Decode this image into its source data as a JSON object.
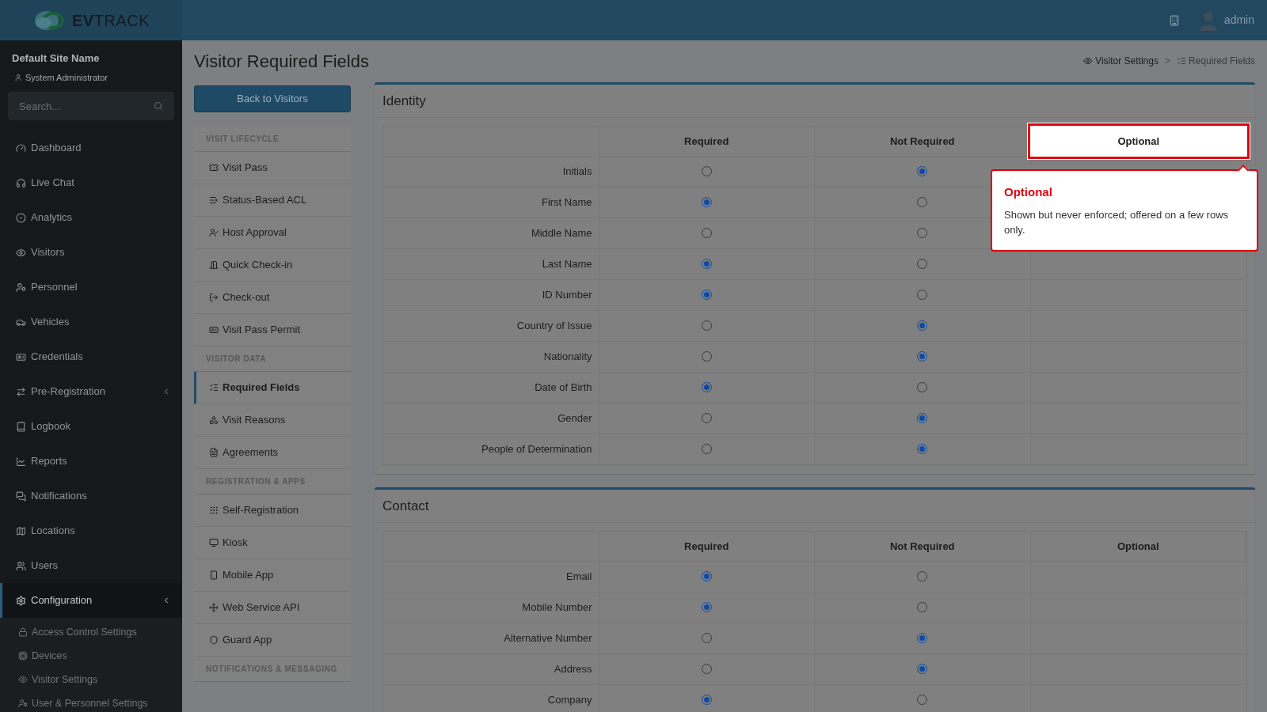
{
  "header": {
    "logo": "**EV**TRACK",
    "user": "admin"
  },
  "sidebar": {
    "site": "Default Site Name",
    "role": "System Administrator",
    "search": {
      "placeholder": "Search..."
    },
    "items": [
      {
        "label": "Dashboard",
        "kind": "link",
        "selected": false
      },
      {
        "label": "Live Chat",
        "kind": "link",
        "selected": false
      },
      {
        "label": "Analytics",
        "kind": "link",
        "selected": false
      },
      {
        "label": "Visitors",
        "kind": "link",
        "selected": false
      },
      {
        "label": "Personnel",
        "kind": "link",
        "selected": false
      },
      {
        "label": "Vehicles",
        "kind": "link",
        "selected": false
      },
      {
        "label": "Credentials",
        "kind": "link",
        "selected": false
      },
      {
        "label": "Pre-Registration",
        "kind": "group",
        "selected": false
      },
      {
        "label": "Logbook",
        "kind": "link",
        "selected": false
      },
      {
        "label": "Reports",
        "kind": "link",
        "selected": false
      },
      {
        "label": "Notifications",
        "kind": "link",
        "selected": false
      },
      {
        "label": "Locations",
        "kind": "link",
        "selected": false
      },
      {
        "label": "Users",
        "kind": "link",
        "selected": false
      },
      {
        "label": "Configuration",
        "kind": "group",
        "selected": true,
        "children": [
          {
            "label": "Access Control Settings"
          },
          {
            "label": "Devices"
          },
          {
            "label": "Visitor Settings"
          },
          {
            "label": "User & Personnel Settings"
          }
        ]
      }
    ]
  },
  "page": {
    "title": "Visitor Required Fields",
    "back_button": "Back to Visitors",
    "breadcrumb": [
      {
        "label": "Visitor Settings"
      },
      {
        "label": "Required Fields"
      }
    ],
    "breadcrumb_separator": ">"
  },
  "settings_menu": [
    {
      "heading": "VISIT LIFECYCLE",
      "items": [
        {
          "label": "Visit Pass",
          "selected": false
        },
        {
          "label": "Status-Based ACL",
          "selected": false
        },
        {
          "label": "Host Approval",
          "selected": false
        },
        {
          "label": "Quick Check-in",
          "selected": false
        },
        {
          "label": "Check-out",
          "selected": false
        },
        {
          "label": "Visit Pass Permit",
          "selected": false
        }
      ]
    },
    {
      "heading": "VISITOR DATA",
      "items": [
        {
          "label": "Required Fields",
          "selected": true
        },
        {
          "label": "Visit Reasons",
          "selected": false
        },
        {
          "label": "Agreements",
          "selected": false
        }
      ]
    },
    {
      "heading": "REGISTRATION & APPS",
      "items": [
        {
          "label": "Self-Registration",
          "selected": false
        },
        {
          "label": "Kiosk",
          "selected": false
        },
        {
          "label": "Mobile App",
          "selected": false
        },
        {
          "label": "Web Service API",
          "selected": false
        },
        {
          "label": "Guard App",
          "selected": false
        }
      ]
    },
    {
      "heading": "NOTIFICATIONS & MESSAGING"
    }
  ],
  "sections": [
    {
      "title": "Identity",
      "columns": [
        {
          "label": "Required",
          "highlighted": false
        },
        {
          "label": "Not Required",
          "highlighted": false
        },
        {
          "label": "Optional",
          "highlighted": true
        }
      ],
      "rows": [
        {
          "label": "Initials",
          "options": [
            {
              "selected": false
            },
            {
              "selected": true
            }
          ]
        },
        {
          "label": "First Name",
          "options": [
            {
              "selected": true
            },
            {
              "selected": false
            }
          ]
        },
        {
          "label": "Middle Name",
          "options": [
            {
              "selected": false
            },
            {
              "selected": false
            }
          ]
        },
        {
          "label": "Last Name",
          "options": [
            {
              "selected": true
            },
            {
              "selected": false
            }
          ]
        },
        {
          "label": "ID Number",
          "options": [
            {
              "selected": true
            },
            {
              "selected": false
            }
          ]
        },
        {
          "label": "Country of Issue",
          "options": [
            {
              "selected": false
            },
            {
              "selected": true
            }
          ]
        },
        {
          "label": "Nationality",
          "options": [
            {
              "selected": false
            },
            {
              "selected": true
            }
          ]
        },
        {
          "label": "Date of Birth",
          "options": [
            {
              "selected": true
            },
            {
              "selected": false
            }
          ]
        },
        {
          "label": "Gender",
          "options": [
            {
              "selected": false
            },
            {
              "selected": true
            }
          ]
        },
        {
          "label": "People of Determination",
          "options": [
            {
              "selected": false
            },
            {
              "selected": true
            }
          ]
        }
      ]
    },
    {
      "title": "Contact",
      "columns": [
        {
          "label": "Required",
          "highlighted": false
        },
        {
          "label": "Not Required",
          "highlighted": false
        },
        {
          "label": "Optional",
          "highlighted": false
        }
      ],
      "rows": [
        {
          "label": "Email",
          "options": [
            {
              "selected": true
            },
            {
              "selected": false
            }
          ]
        },
        {
          "label": "Mobile Number",
          "options": [
            {
              "selected": true
            },
            {
              "selected": false
            }
          ]
        },
        {
          "label": "Alternative Number",
          "options": [
            {
              "selected": false
            },
            {
              "selected": true
            }
          ]
        },
        {
          "label": "Address",
          "options": [
            {
              "selected": false
            },
            {
              "selected": true
            }
          ]
        },
        {
          "label": "Company",
          "options": [
            {
              "selected": true
            },
            {
              "selected": false
            }
          ]
        }
      ]
    }
  ],
  "tooltip": {
    "title": "Optional",
    "text": "Shown but never enforced; offered on a few rows only."
  }
}
